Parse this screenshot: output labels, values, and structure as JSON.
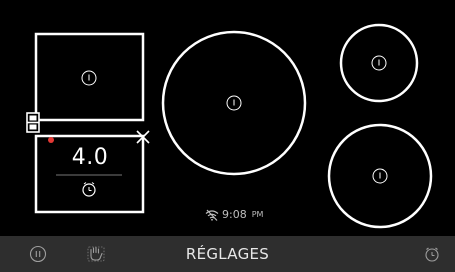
{
  "zones": {
    "left_bridge": {
      "power_level": "4.0",
      "active_indicator_color": "#e53935"
    },
    "center_large": {
      "state": "off"
    },
    "top_right_small": {
      "state": "off"
    },
    "bottom_right": {
      "state": "off"
    }
  },
  "status": {
    "wifi_icon": "wifi-off-icon",
    "time": "9:08",
    "ampm": "PM"
  },
  "bottom_bar": {
    "settings_label": "RÉGLAGES",
    "left_icons": [
      "pause-icon",
      "lock-hand-icon"
    ],
    "right_icon": "kitchen-timer-icon"
  },
  "colors": {
    "background": "#000000",
    "outline": "#ffffff",
    "bar": "#2e2e2e",
    "indicator": "#e53935"
  }
}
